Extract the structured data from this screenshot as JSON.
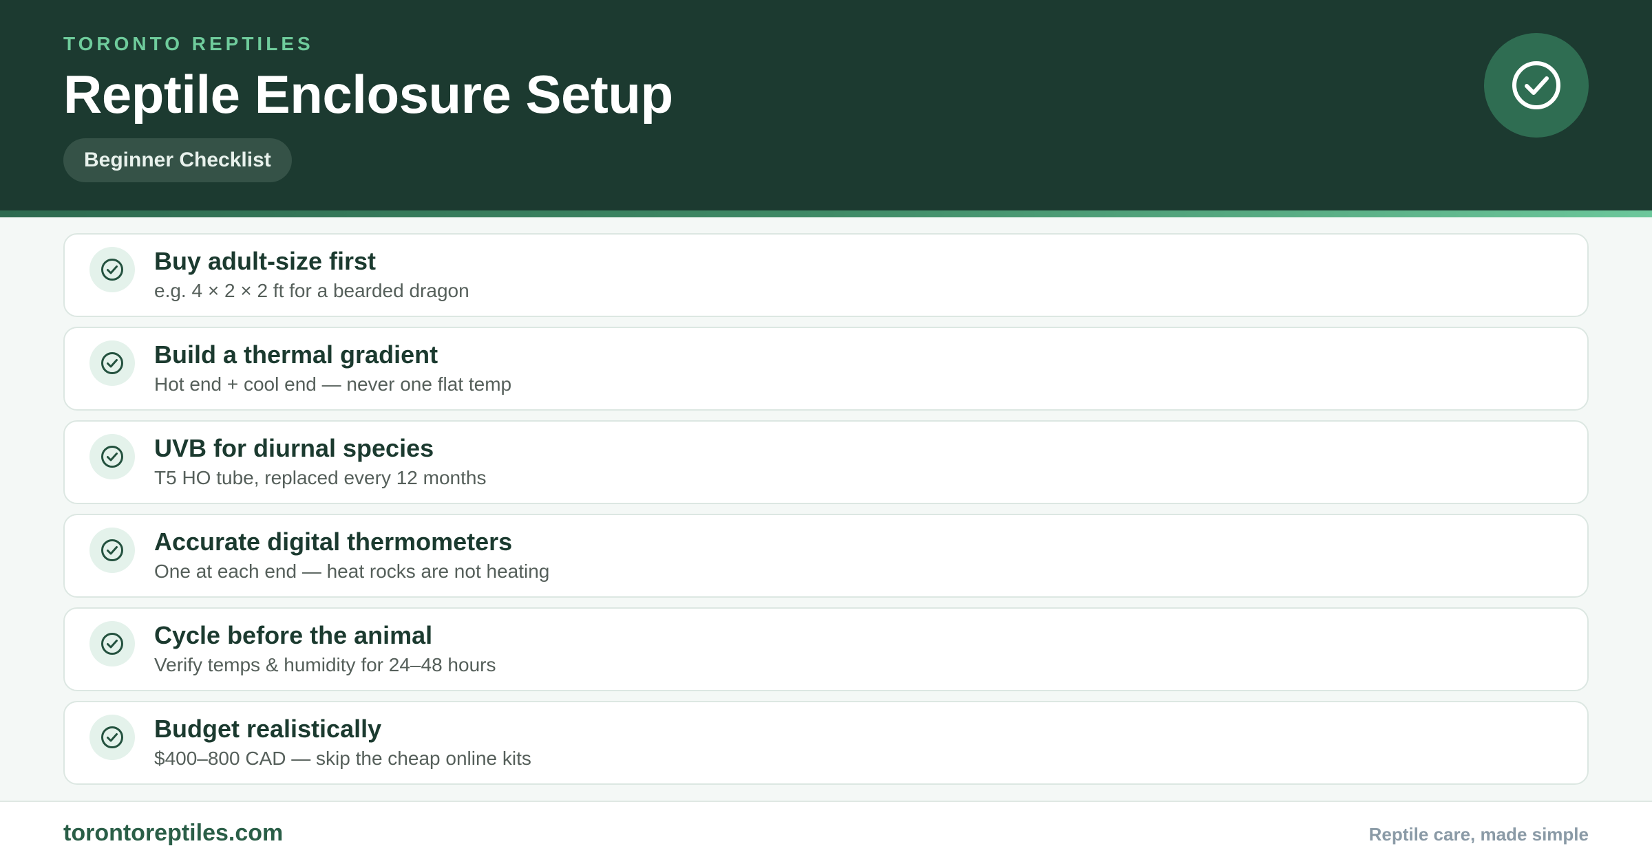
{
  "header": {
    "brand": "TORONTO REPTILES",
    "title": "Reptile Enclosure Setup",
    "subtitle": "Beginner Checklist",
    "badge_icon": "check-circle-icon"
  },
  "checklist": [
    {
      "title": "Buy adult-size first",
      "description": "e.g. 4 × 2 × 2 ft for a bearded dragon"
    },
    {
      "title": "Build a thermal gradient",
      "description": "Hot end + cool end — never one flat temp"
    },
    {
      "title": "UVB for diurnal species",
      "description": "T5 HO tube, replaced every 12 months"
    },
    {
      "title": "Accurate digital thermometers",
      "description": "One at each end — heat rocks are not heating"
    },
    {
      "title": "Cycle before the animal",
      "description": "Verify temps & humidity for 24–48 hours"
    },
    {
      "title": "Budget realistically",
      "description": "$400–800 CAD — skip the cheap online kits"
    }
  ],
  "footer": {
    "site": "torontoreptiles.com",
    "tagline": "Reptile care, made simple"
  },
  "colors": {
    "header_bg": "#1c3a30",
    "accent": "#6fcc9c",
    "title_text": "#1b3a2f"
  }
}
